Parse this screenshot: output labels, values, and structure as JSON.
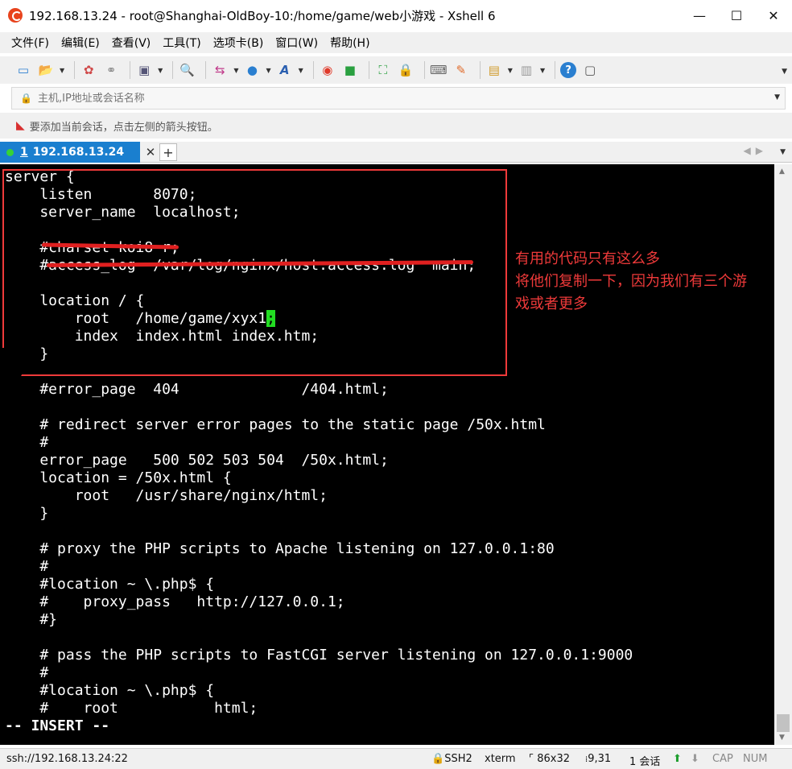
{
  "window": {
    "title": "192.168.13.24 - root@Shanghai-OldBoy-10:/home/game/web小游戏 - Xshell 6",
    "controls": {
      "minimize": "—",
      "maximize": "☐",
      "close": "✕"
    }
  },
  "menu": [
    {
      "label": "文件(F)"
    },
    {
      "label": "编辑(E)"
    },
    {
      "label": "查看(V)"
    },
    {
      "label": "工具(T)"
    },
    {
      "label": "选项卡(B)"
    },
    {
      "label": "窗口(W)"
    },
    {
      "label": "帮助(H)"
    }
  ],
  "toolbar": {
    "icons": [
      "new-session-icon",
      "open-folder-icon",
      "reconnect-icon",
      "disconnect-icon",
      "properties-icon",
      "find-icon",
      "transfer-icon",
      "globe-icon",
      "font-icon",
      "xshell-icon",
      "xftp-icon",
      "fullscreen-icon",
      "lock-icon",
      "keyboard-icon",
      "highlight-icon",
      "script-icon",
      "layout-icon",
      "help-icon",
      "chat-icon"
    ],
    "glyphs": {
      "new": "▭",
      "open": "📂",
      "reconnect": "✿",
      "disconnect": "⚭",
      "properties": "▣",
      "find": "🔍",
      "transfer": "⇆",
      "globe": "●",
      "font": "A",
      "xshell": "◉",
      "xftp": "■",
      "fullscreen": "⛶",
      "lock": "🔒",
      "keyboard": "⌨",
      "highlight": "✎",
      "script": "▤",
      "layout": "▥",
      "help": "?",
      "chat": "▢"
    }
  },
  "address_bar": {
    "placeholder": "主机,IP地址或会话名称"
  },
  "hint": {
    "text": "要添加当前会话，点击左侧的箭头按钮。"
  },
  "tab": {
    "number": "1",
    "label": "192.168.13.24",
    "close": "✕",
    "add": "+"
  },
  "terminal": {
    "lines": [
      "server {",
      "    listen       8070;",
      "    server_name  localhost;",
      "",
      "    #charset koi8-r;",
      "    #access_log  /var/log/nginx/host.access.log  main;",
      "",
      "    location / {",
      "        root   /home/game/xyx1",
      "        index  index.html index.htm;",
      "    }",
      "}",
      "    #error_page  404              /404.html;",
      "",
      "    # redirect server error pages to the static page /50x.html",
      "    #",
      "    error_page   500 502 503 504  /50x.html;",
      "    location = /50x.html {",
      "        root   /usr/share/nginx/html;",
      "    }",
      "",
      "    # proxy the PHP scripts to Apache listening on 127.0.0.1:80",
      "    #",
      "    #location ~ \\.php$ {",
      "    #    proxy_pass   http://127.0.0.1;",
      "    #}",
      "",
      "    # pass the PHP scripts to FastCGI server listening on 127.0.0.1:9000",
      "    #",
      "    #location ~ \\.php$ {",
      "    #    root           html;",
      "-- INSERT --"
    ],
    "cursor_char": ";"
  },
  "annotation": {
    "lines": [
      "有用的代码只有这么多",
      "将他们复制一下，因为我们有三个游",
      "戏或者更多"
    ],
    "color": "#ef3a3a"
  },
  "status": {
    "connection": "ssh://192.168.13.24:22",
    "protocol": "SSH2",
    "terminal_type": "xterm",
    "size": "86x32",
    "position": "9,31",
    "sessions": "1 会话",
    "caps": "CAP",
    "num": "NUM"
  }
}
